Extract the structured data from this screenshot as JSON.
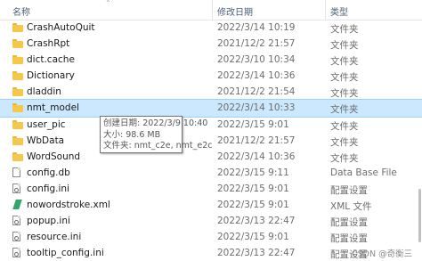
{
  "columns": {
    "name": "名称",
    "date": "修改日期",
    "type": "类型"
  },
  "files": [
    {
      "name": "CrashAutoQuit",
      "date": "2022/3/14 10:19",
      "type": "文件夹",
      "icon": "folder-icon"
    },
    {
      "name": "CrashRpt",
      "date": "2021/12/2 21:57",
      "type": "文件夹",
      "icon": "folder-icon"
    },
    {
      "name": "dict.cache",
      "date": "2022/3/10 10:34",
      "type": "文件夹",
      "icon": "folder-icon"
    },
    {
      "name": "Dictionary",
      "date": "2022/3/14 10:36",
      "type": "文件夹",
      "icon": "folder-icon"
    },
    {
      "name": "dladdin",
      "date": "2021/12/2 21:54",
      "type": "文件夹",
      "icon": "folder-icon"
    },
    {
      "name": "nmt_model",
      "date": "2022/3/14 10:33",
      "type": "文件夹",
      "icon": "folder-icon"
    },
    {
      "name": "user_pic",
      "date": "2022/3/15 9:01",
      "type": "文件夹",
      "icon": "folder-icon"
    },
    {
      "name": "WbData",
      "date": "2021/12/2 21:57",
      "type": "文件夹",
      "icon": "folder-icon"
    },
    {
      "name": "WordSound",
      "date": "2022/3/14 10:36",
      "type": "文件夹",
      "icon": "folder-icon"
    },
    {
      "name": "config.db",
      "date": "2022/3/15 9:11",
      "type": "Data Base File",
      "icon": "file-icon"
    },
    {
      "name": "config.ini",
      "date": "2022/3/15 9:01",
      "type": "配置设置",
      "icon": "settings-file-icon"
    },
    {
      "name": "nowordstroke.xml",
      "date": "2022/3/15 9:01",
      "type": "XML 文件",
      "icon": "xml-file-icon"
    },
    {
      "name": "popup.ini",
      "date": "2022/3/13 22:47",
      "type": "配置设置",
      "icon": "settings-file-icon"
    },
    {
      "name": "resource.ini",
      "date": "2022/3/15 9:01",
      "type": "配置设置",
      "icon": "settings-file-icon"
    },
    {
      "name": "tooltip_config.ini",
      "date": "2022/3/13 22:47",
      "type": "配置设置",
      "icon": "settings-file-icon"
    }
  ],
  "selected_index": 5,
  "tooltip": {
    "created": "创建日期: 2022/3/9 10:40",
    "size": "大小: 98.6 MB",
    "folders": "文件夹: nmt_c2e, nmt_e2c"
  },
  "watermark": "CSDN @奇衡三",
  "colors": {
    "selected_bg": "#cce8ff",
    "folder": "#f5c84c"
  }
}
